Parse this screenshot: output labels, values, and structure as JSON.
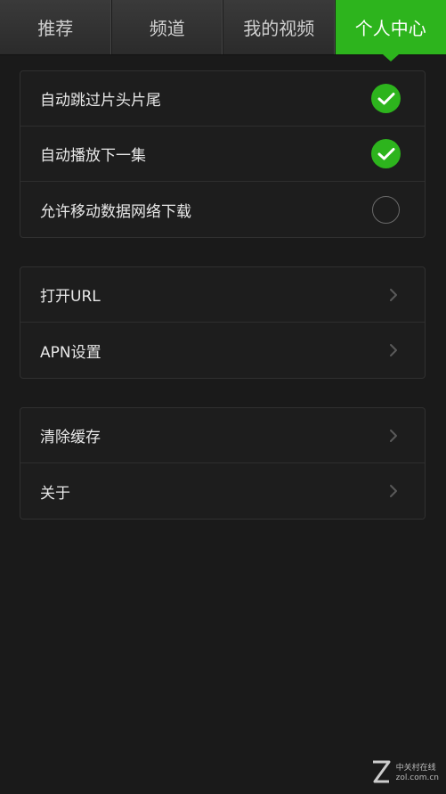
{
  "tabs": [
    {
      "label": "推荐",
      "active": false
    },
    {
      "label": "频道",
      "active": false
    },
    {
      "label": "我的视频",
      "active": false
    },
    {
      "label": "个人中心",
      "active": true
    }
  ],
  "playback_settings": [
    {
      "label": "自动跳过片头片尾",
      "checked": true
    },
    {
      "label": "自动播放下一集",
      "checked": true
    },
    {
      "label": "允许移动数据网络下载",
      "checked": false
    }
  ],
  "network_settings": [
    {
      "label": "打开URL"
    },
    {
      "label": "APN设置"
    }
  ],
  "misc_settings": [
    {
      "label": "清除缓存"
    },
    {
      "label": "关于"
    }
  ],
  "watermark": {
    "name": "中关村在线",
    "domain": "zol.com.cn"
  },
  "colors": {
    "accent": "#2db41d",
    "background": "#1a1a1a",
    "row_background": "#1d1d1d"
  }
}
